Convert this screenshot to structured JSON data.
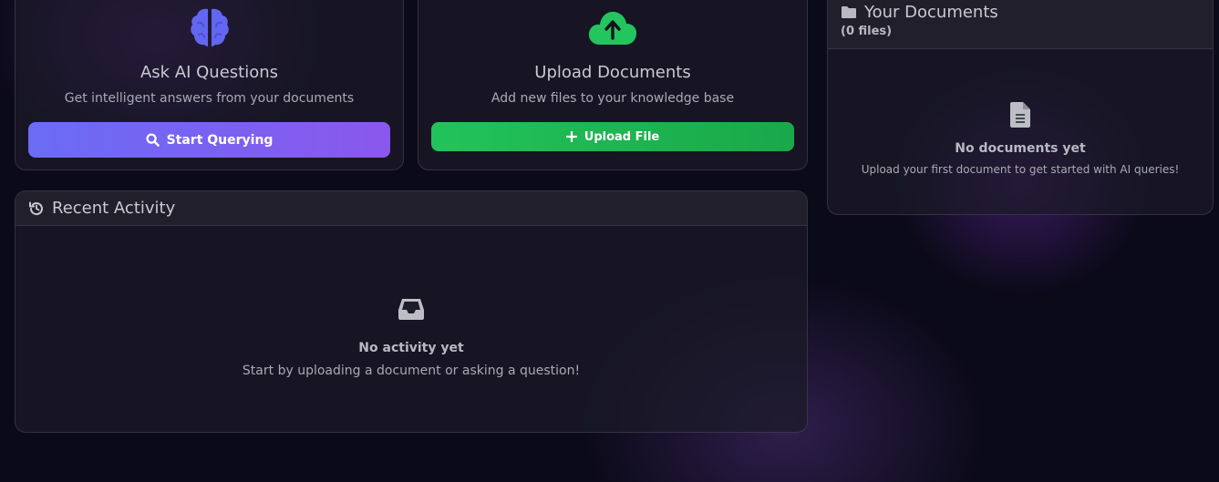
{
  "ask_card": {
    "icon": "brain-icon",
    "title": "Ask AI Questions",
    "description": "Get intelligent answers from your documents",
    "button_label": "Start Querying",
    "button_icon": "search-icon",
    "icon_color": "#6366f1",
    "button_colors": [
      "#6a6cf6",
      "#8a58ec"
    ]
  },
  "upload_card": {
    "icon": "cloud-upload-icon",
    "title": "Upload Documents",
    "description": "Add new files to your knowledge base",
    "button_label": "Upload File",
    "button_icon": "plus-icon",
    "icon_color": "#22c55e",
    "button_colors": [
      "#22c35a",
      "#1aa84a"
    ]
  },
  "documents_panel": {
    "icon": "folder-icon",
    "title": "Your Documents",
    "count_label": "(0 files)",
    "empty_icon": "file-icon",
    "empty_title": "No documents yet",
    "empty_subtitle": "Upload your first document to get started with AI queries!"
  },
  "activity_panel": {
    "icon": "history-icon",
    "title": "Recent Activity",
    "empty_icon": "inbox-icon",
    "empty_title": "No activity yet",
    "empty_subtitle": "Start by uploading a document or asking a question!"
  }
}
